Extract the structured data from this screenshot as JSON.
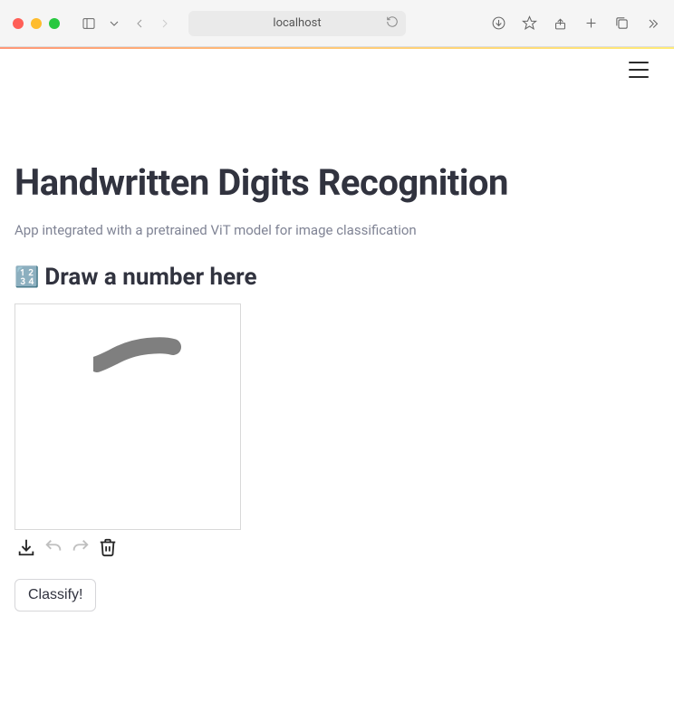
{
  "browser": {
    "url_display": "localhost"
  },
  "page": {
    "title": "Handwritten Digits Recognition",
    "subtitle": "App integrated with a pretrained ViT model for image classification",
    "section_emoji": "🔢",
    "section_title": "Draw a number here",
    "classify_label": "Classify!"
  },
  "canvas_tools": {
    "download": "download",
    "undo": "undo",
    "redo": "redo",
    "trash": "trash"
  }
}
